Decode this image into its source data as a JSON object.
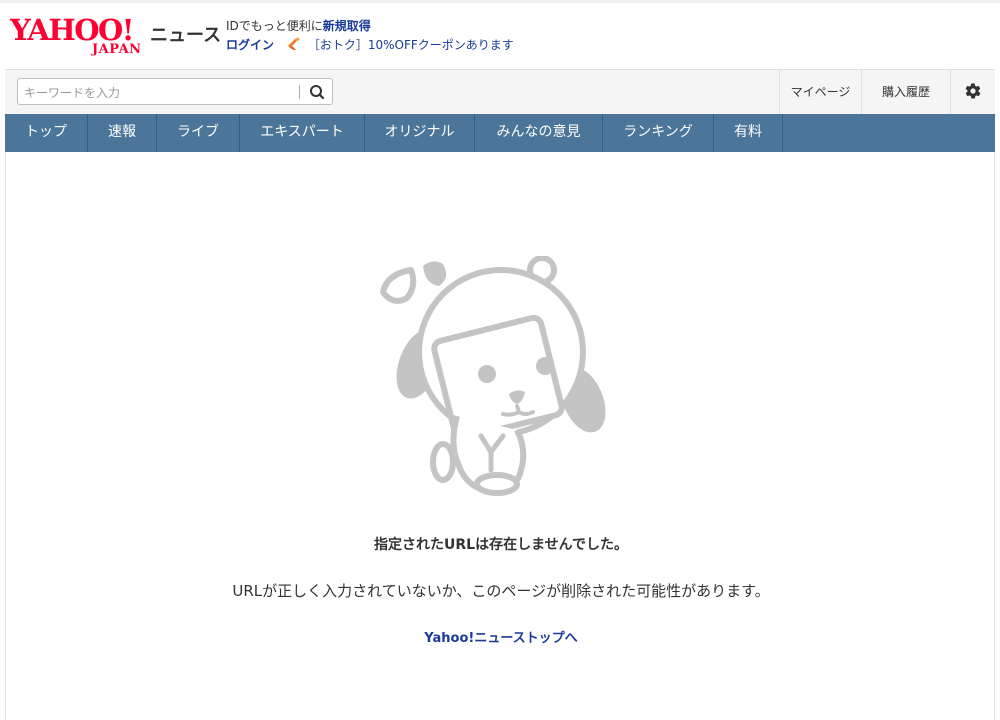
{
  "header": {
    "logo_main": "YAHOO!",
    "logo_sub": "JAPAN",
    "service_name": "ニュース",
    "promo_text": "IDでもっと便利に",
    "signup_label": "新規取得",
    "login_label": "ログイン",
    "coupon_text": "［おトク］10%OFFクーポンあります"
  },
  "search": {
    "placeholder": "キーワードを入力",
    "value": ""
  },
  "user_links": {
    "mypage": "マイページ",
    "history": "購入履歴"
  },
  "nav": {
    "items": [
      {
        "label": "トップ"
      },
      {
        "label": "速報"
      },
      {
        "label": "ライブ"
      },
      {
        "label": "エキスパート"
      },
      {
        "label": "オリジナル"
      },
      {
        "label": "みんなの意見"
      },
      {
        "label": "ランキング"
      },
      {
        "label": "有料"
      }
    ]
  },
  "error": {
    "title": "指定されたURLは存在しませんでした。",
    "description": "URLが正しく入力されていないか、このページが削除された可能性があります。",
    "back_link": "Yahoo!ニューストップへ"
  },
  "icons": {
    "search": "search-icon",
    "settings": "gear-icon",
    "coupon": "coupon-icon",
    "mascot": "mascot-illustration"
  },
  "colors": {
    "brand_red": "#ff0033",
    "nav_bg": "#4b7699",
    "link_blue": "#1a3a99",
    "mascot_gray": "#c4c4c4"
  }
}
